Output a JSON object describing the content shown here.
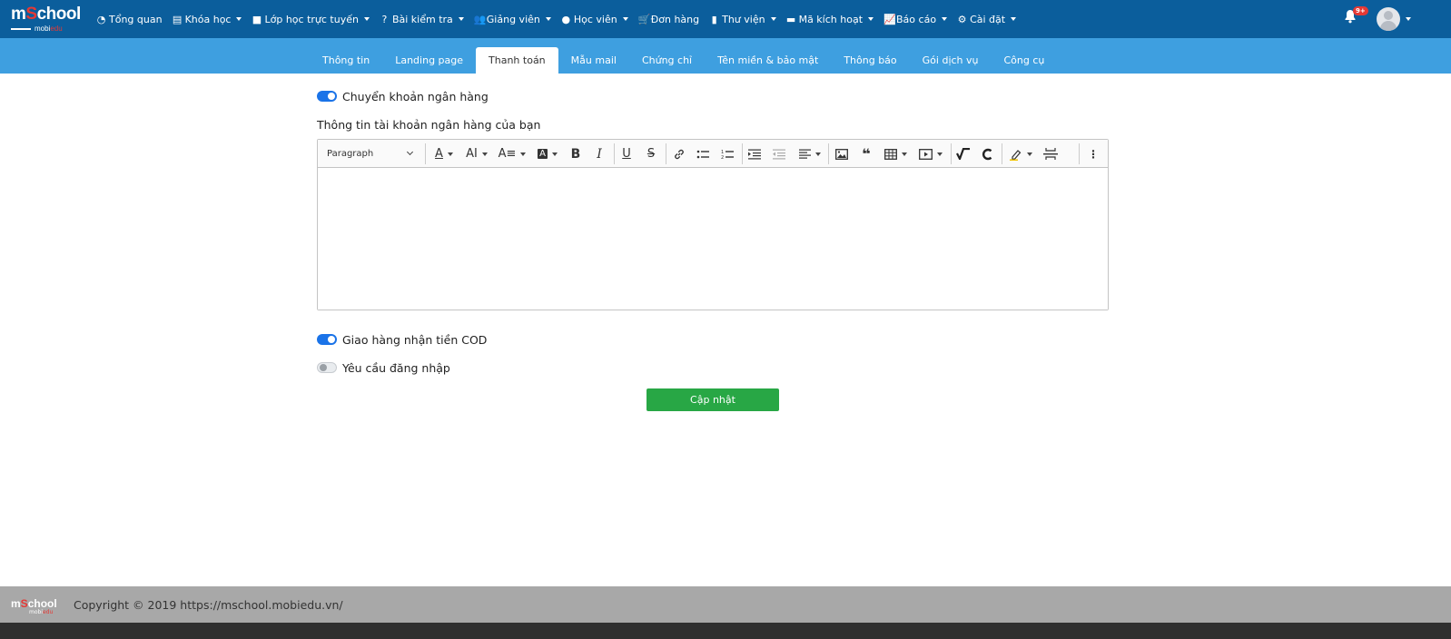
{
  "brand": {
    "logo_main_prefix": "m",
    "logo_main_o": "S",
    "logo_main_suffix": "chool",
    "logo_sub_a": "mobi",
    "logo_sub_b": "edu"
  },
  "nav": {
    "items": [
      {
        "label": "Tổng quan",
        "icon": "dashboard-icon",
        "caret": false
      },
      {
        "label": "Khóa học",
        "icon": "table-icon",
        "caret": true
      },
      {
        "label": "Lớp học trực tuyến",
        "icon": "video-icon",
        "caret": true
      },
      {
        "label": "Bài kiểm tra",
        "icon": "question-icon",
        "caret": true
      },
      {
        "label": "Giảng viên",
        "icon": "users-icon",
        "caret": true
      },
      {
        "label": "Học viên",
        "icon": "user-icon",
        "caret": true
      },
      {
        "label": "Đơn hàng",
        "icon": "cart-icon",
        "caret": false
      },
      {
        "label": "Thư viện",
        "icon": "book-icon",
        "caret": true
      },
      {
        "label": "Mã kích hoạt",
        "icon": "card-icon",
        "caret": true
      },
      {
        "label": "Báo cáo",
        "icon": "chart-icon",
        "caret": true
      },
      {
        "label": "Cài đặt",
        "icon": "gears-icon",
        "caret": true
      }
    ],
    "notification_badge": "9+"
  },
  "tabs": [
    {
      "label": "Thông tin",
      "active": false
    },
    {
      "label": "Landing page",
      "active": false
    },
    {
      "label": "Thanh toán",
      "active": true
    },
    {
      "label": "Mẫu mail",
      "active": false
    },
    {
      "label": "Chứng chỉ",
      "active": false
    },
    {
      "label": "Tên miền & bảo mật",
      "active": false
    },
    {
      "label": "Thông báo",
      "active": false
    },
    {
      "label": "Gói dịch vụ",
      "active": false
    },
    {
      "label": "Công cụ",
      "active": false
    }
  ],
  "form": {
    "bank_transfer": {
      "label": "Chuyển khoản ngân hàng",
      "enabled": true
    },
    "bank_info_label": "Thông tin tài khoản ngân hàng của bạn",
    "editor": {
      "heading_select": "Paragraph",
      "content": ""
    },
    "cod": {
      "label": "Giao hàng nhận tiền COD",
      "enabled": true
    },
    "require_login": {
      "label": "Yêu cầu đăng nhập",
      "enabled": false
    },
    "submit_label": "Cập nhật"
  },
  "footer": {
    "copyright": "Copyright © 2019 https://mschool.mobiedu.vn/"
  },
  "colors": {
    "nav_bg": "#0b5e9c",
    "tab_bg": "#3e9fe0",
    "accent": "#1a73e8",
    "submit": "#28a745",
    "footer_bg": "#a8a8a8",
    "badge": "#e53935"
  }
}
